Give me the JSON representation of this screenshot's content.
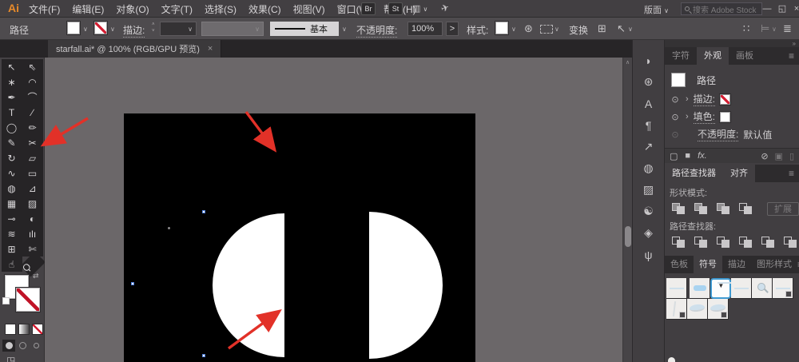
{
  "colors": {
    "accent_blue": "#3f9ad2",
    "annotation_red": "#e23128",
    "logo_orange": "#e78a2a",
    "none_red": "#d41d32",
    "artboard": "#000000",
    "pasteboard": "#6b6769"
  },
  "menu": {
    "logo": "Ai",
    "items": [
      {
        "name": "menu-file",
        "label": "文件(F)"
      },
      {
        "name": "menu-edit",
        "label": "编辑(E)"
      },
      {
        "name": "menu-object",
        "label": "对象(O)"
      },
      {
        "name": "menu-type",
        "label": "文字(T)"
      },
      {
        "name": "menu-select",
        "label": "选择(S)"
      },
      {
        "name": "menu-effect",
        "label": "效果(C)"
      },
      {
        "name": "menu-view",
        "label": "视图(V)"
      },
      {
        "name": "menu-window",
        "label": "窗口(W)"
      },
      {
        "name": "menu-help",
        "label": "帮助(H)"
      }
    ],
    "badge_br": "Br",
    "badge_st": "St",
    "workspace_label": "版面",
    "search_placeholder": "搜索 Adobe Stock"
  },
  "window": {
    "minimize": "—",
    "restore": "◱",
    "close": "×"
  },
  "control": {
    "context_label": "路径",
    "stroke_label": "描边:",
    "brush_name": "基本",
    "opacity_label": "不透明度:",
    "opacity_value": "100%",
    "more": ">",
    "style_label": "样式:",
    "transform_label": "变换"
  },
  "tab": {
    "title": "starfall.ai* @ 100% (RGB/GPU 预览)",
    "close": "×"
  },
  "tools": [
    {
      "name": "selection-tool",
      "glyph": "↖",
      "cls": "selected"
    },
    {
      "name": "direct-selection-tool",
      "glyph": "⇖"
    },
    {
      "name": "magic-wand-tool",
      "glyph": "∗"
    },
    {
      "name": "lasso-tool",
      "glyph": "◠"
    },
    {
      "name": "pen-tool",
      "glyph": "✒"
    },
    {
      "name": "curvature-tool",
      "glyph": "⌒"
    },
    {
      "name": "type-tool",
      "glyph": "T"
    },
    {
      "name": "line-segment-tool",
      "glyph": "∕"
    },
    {
      "name": "ellipse-tool",
      "glyph": "◯"
    },
    {
      "name": "paintbrush-tool",
      "glyph": "✏"
    },
    {
      "name": "shaper-tool",
      "glyph": "✎"
    },
    {
      "name": "scissors-tool",
      "glyph": "✂"
    },
    {
      "name": "rotate-tool",
      "glyph": "↻"
    },
    {
      "name": "scale-tool",
      "glyph": "▱"
    },
    {
      "name": "width-tool",
      "glyph": "∿"
    },
    {
      "name": "free-transform-tool",
      "glyph": "▭"
    },
    {
      "name": "shape-builder-tool",
      "glyph": "◍"
    },
    {
      "name": "perspective-grid-tool",
      "glyph": "⊿"
    },
    {
      "name": "mesh-tool",
      "glyph": "▦"
    },
    {
      "name": "gradient-tool",
      "glyph": "▨"
    },
    {
      "name": "eyedropper-tool",
      "glyph": "⊸"
    },
    {
      "name": "blend-tool",
      "glyph": "◐"
    },
    {
      "name": "symbol-sprayer-tool",
      "glyph": "≋"
    },
    {
      "name": "graph-tool",
      "glyph": "ılı"
    },
    {
      "name": "artboard-tool",
      "glyph": "⊞"
    },
    {
      "name": "slice-tool",
      "glyph": "✄"
    },
    {
      "name": "hand-tool",
      "glyph": "☝"
    },
    {
      "name": "zoom-tool",
      "glyph": "Ϙ",
      "cls": "rot45"
    }
  ],
  "dock_icons": [
    {
      "name": "color-guide-panel-icon",
      "glyph": "◗"
    },
    {
      "name": "node-preview-panel-icon",
      "glyph": "⊛"
    },
    {
      "name": "character-styles-panel-icon",
      "glyph": "A"
    },
    {
      "name": "paragraph-styles-panel-icon",
      "glyph": "¶"
    },
    {
      "name": "export-panel-icon",
      "glyph": "↗"
    },
    {
      "name": "transparency-panel-icon",
      "glyph": "◍"
    },
    {
      "name": "gradient-panel-icon",
      "glyph": "▨"
    },
    {
      "name": "color-panel-icon",
      "glyph": "☯"
    },
    {
      "name": "layers-panel-icon",
      "glyph": "◈"
    },
    {
      "name": "symbol-tools-panel-icon",
      "glyph": "ψ"
    }
  ],
  "panels": {
    "appearance": {
      "tabs": [
        {
          "name": "tab-character",
          "label": "字符"
        },
        {
          "name": "tab-appearance",
          "label": "外观",
          "cls": "active"
        },
        {
          "name": "tab-artboards",
          "label": "画板"
        }
      ],
      "entry_label": "路径",
      "stroke_label": "描边:",
      "fill_label": "填色:",
      "opacity_label": "不透明度:",
      "opacity_value": "默认值"
    },
    "pathfinder": {
      "tabs": [
        {
          "name": "tab-pathfinder",
          "label": "路径查找器",
          "cls": "active"
        },
        {
          "name": "tab-align",
          "label": "对齐"
        }
      ],
      "shape_modes_label": "形状模式:",
      "shape_mode_buttons": [
        {
          "name": "unite-button"
        },
        {
          "name": "minus-front-button"
        },
        {
          "name": "intersect-button"
        },
        {
          "name": "exclude-button",
          "cls": "hollow"
        }
      ],
      "expand_label": "扩展",
      "pathfinder_label": "路径查找器:",
      "pathfinder_buttons": [
        {
          "name": "divide-button",
          "cls": "hollow"
        },
        {
          "name": "trim-button",
          "cls": "hollow"
        },
        {
          "name": "merge-button"
        },
        {
          "name": "crop-button",
          "cls": "hollow"
        },
        {
          "name": "outline-button",
          "cls": "hollow"
        },
        {
          "name": "minus-back-button"
        }
      ]
    },
    "symbols": {
      "tabs": [
        {
          "name": "tab-swatches",
          "label": "色板"
        },
        {
          "name": "tab-symbols",
          "label": "符号",
          "cls": "active"
        },
        {
          "name": "tab-stroke",
          "label": "描边"
        },
        {
          "name": "tab-graphic-styles",
          "label": "图形样式"
        }
      ],
      "thumbs": [
        {
          "name": "symbol-thumb-line",
          "cls": "k-line"
        },
        {
          "name": "symbol-thumb-button",
          "cls": "k-pill"
        },
        {
          "name": "symbol-thumb-dropdown-selected",
          "cls": "k-dropdown"
        },
        {
          "name": "symbol-thumb-line2",
          "cls": "k-line"
        },
        {
          "name": "symbol-thumb-magnifier",
          "cls": "k-mag"
        },
        {
          "name": "symbol-thumb-blank",
          "cls": "badged"
        },
        {
          "name": "symbol-thumb-streak",
          "cls": "k-streak badged"
        },
        {
          "name": "symbol-thumb-wave",
          "cls": "k-wave"
        },
        {
          "name": "symbol-thumb-wave2",
          "cls": "k-wave badged"
        }
      ]
    }
  },
  "icons": {
    "chev": "∨",
    "chev_right": "›",
    "stepper_up": "˄",
    "stepper_dn": "˅",
    "recolor": "⊛",
    "select_cursor": "↖",
    "grid_dots": "∷",
    "align_bar": "⊨",
    "list": "≣",
    "panel_menu": "≡",
    "collapse": "»",
    "eye": "⊙",
    "sq_outline": "▢",
    "sq_fill": "■",
    "fx": "fx.",
    "clear": "⊘",
    "duplicate": "▣",
    "trash": "▯",
    "swap": "⇄",
    "screen_mode": "◳",
    "scroll_up": "∧",
    "ws_grid": "▥",
    "plane": "✈",
    "align_icon": "⊞"
  }
}
